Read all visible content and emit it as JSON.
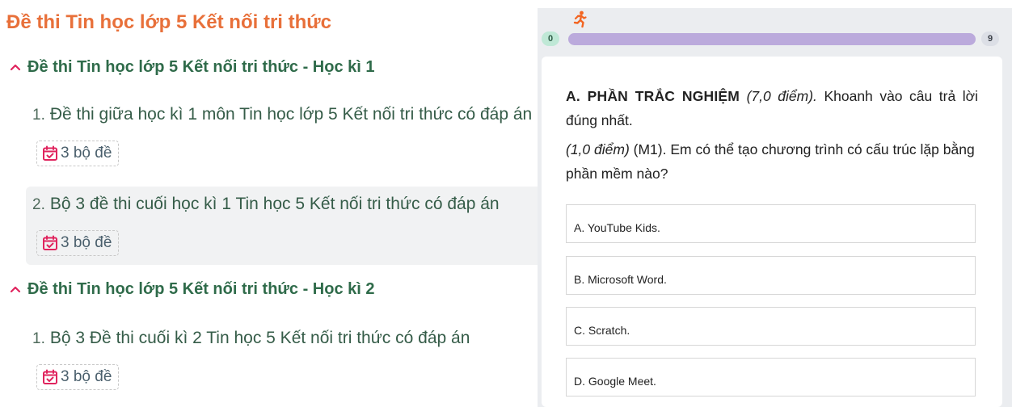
{
  "page": {
    "title": "Đề thi Tin học lớp 5 Kết nối tri thức"
  },
  "sections": [
    {
      "title": "Đề thi Tin học lớp 5 Kết nối tri thức - Học kì 1",
      "items": [
        {
          "num": "1.",
          "name": "Đề thi giữa học kì 1 môn Tin học lớp 5 Kết nối tri thức có đáp án",
          "count": "3 bộ đề",
          "highlighted": false
        },
        {
          "num": "2.",
          "name": "Bộ 3 đề thi cuối học kì 1 Tin học 5 Kết nối tri thức có đáp án",
          "count": "3 bộ đề",
          "highlighted": true
        }
      ]
    },
    {
      "title": "Đề thi Tin học lớp 5 Kết nối tri thức - Học kì 2",
      "items": [
        {
          "num": "1.",
          "name": "Bộ 3 Đề thi cuối kì 2 Tin học 5 Kết nối tri thức có đáp án",
          "count": "3 bộ đề",
          "highlighted": false
        }
      ]
    }
  ],
  "quiz": {
    "progress": {
      "start": "0",
      "end": "9",
      "fraction": 1.0
    },
    "runner_icon": "running-person-icon",
    "part_heading": "A. PHẦN TRẮC NGHIỆM",
    "part_points": "(7,0 điểm).",
    "part_instruction": "Khoanh vào câu trả lời đúng nhất.",
    "question_points": "(1,0 điểm)",
    "question_level": "(M1).",
    "question_text": "Em có thể tạo chương trình có cấu trúc lặp bằng phần mềm nào?",
    "options": [
      "A. YouTube Kids.",
      "B. Microsoft Word.",
      "C. Scratch.",
      "D. Google Meet."
    ]
  },
  "colors": {
    "title": "#e8703a",
    "section": "#2f6b4a",
    "badge_icon": "#e0245e",
    "runner": "#f26522",
    "progress": "#bbaadc"
  }
}
